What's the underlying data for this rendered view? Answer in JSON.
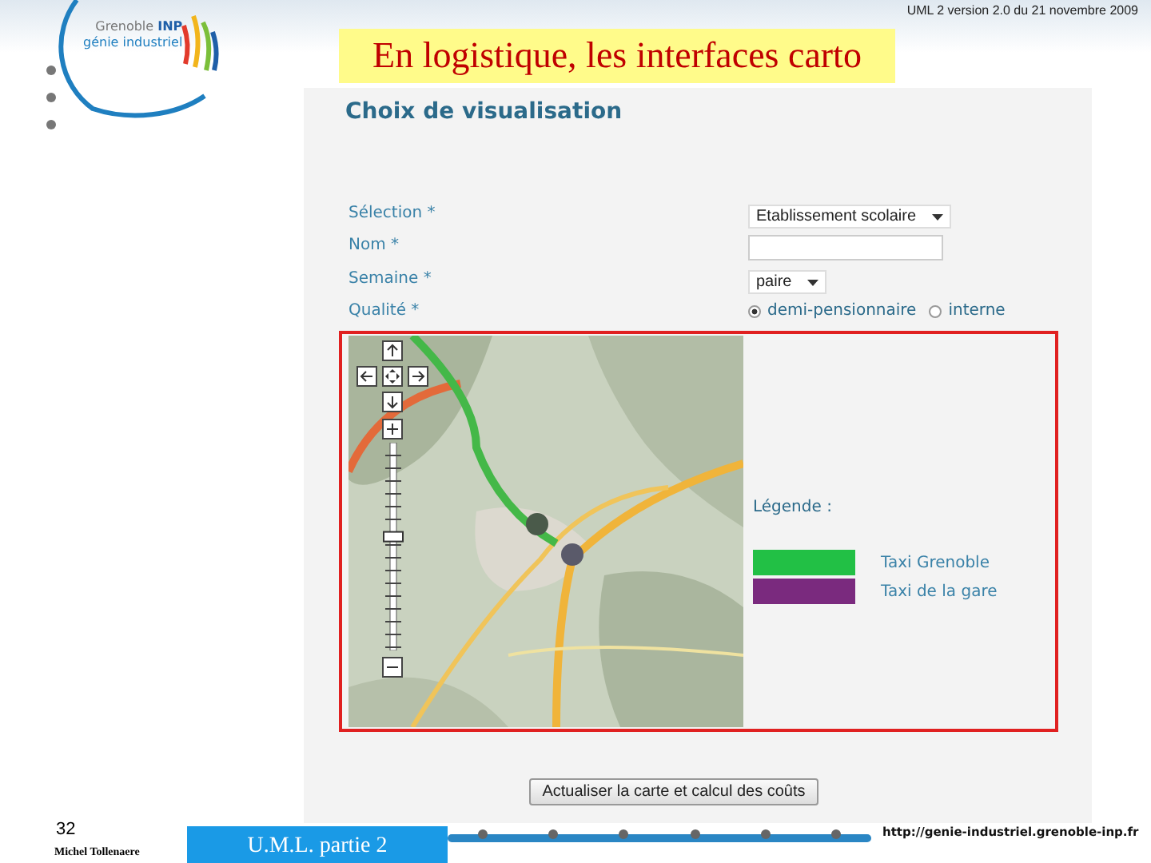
{
  "slide_header": {
    "version_note": "UML 2 version 2.0  du  21 novembre 2009",
    "title": "En logistique, les interfaces carto"
  },
  "logo": {
    "line_1": "Grenoble",
    "line_1_mark": "INP",
    "line_2": "génie industriel"
  },
  "form": {
    "heading": "Choix de visualisation",
    "fields": [
      {
        "label": "Sélection *",
        "kind": "select",
        "value": "Etablissement scolaire"
      },
      {
        "label": "Nom *",
        "kind": "text"
      },
      {
        "label": "Semaine *",
        "kind": "select",
        "value": "paire"
      },
      {
        "label": "Qualité *",
        "kind": "radio",
        "options": [
          {
            "label": "demi-pensionnaire",
            "selected": true
          },
          {
            "label": "interne",
            "selected": false
          }
        ]
      }
    ]
  },
  "map_zoom": {
    "level": 0.55
  },
  "legend": {
    "title": "Légende :",
    "items": [
      {
        "label": "Taxi Grenoble",
        "color": "#22c045"
      },
      {
        "label": "Taxi de la gare",
        "color": "#7a2a7e"
      }
    ]
  },
  "button": "Actualiser la carte et calcul des coûts",
  "footer": {
    "page_number": "32",
    "author": "Michel Tollenaere",
    "section": "U.M.L. partie 2",
    "url": "http://genie-industriel.grenoble-inp.fr"
  }
}
